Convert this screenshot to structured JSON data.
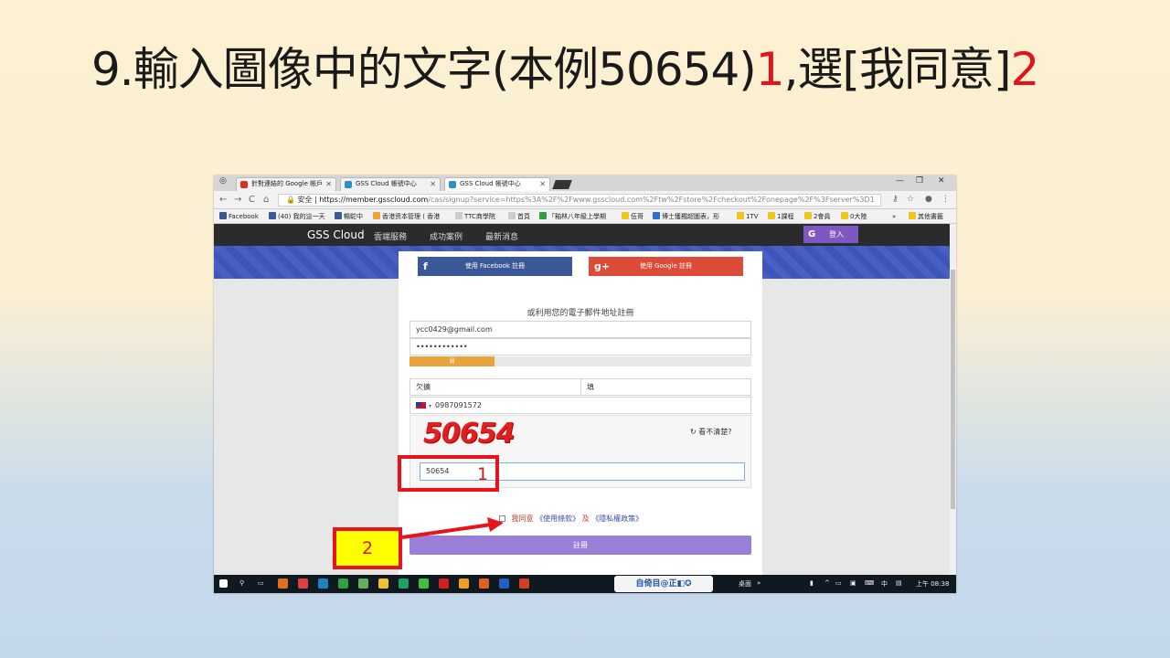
{
  "slide": {
    "title_main": "9.輸入圖像中的文字(本例50654)",
    "title_num1": "1",
    "title_mid": ",選[我同意]",
    "title_num2": "2"
  },
  "browser": {
    "tabs": [
      {
        "label": "針對連結的 Google 帳戶"
      },
      {
        "label": "GSS Cloud 帳號中心"
      },
      {
        "label": "GSS Cloud 帳號中心"
      }
    ],
    "security_label": "安全",
    "url_host": "https://member.gsscloud.com",
    "url_rest": "/cas/signup?service=https%3A%2F%2Fwww.gsscloud.com%2Ftw%2Fstore%2Fcheckout%2Fonepage%2F%3Fserver%3D1",
    "bookmarks": [
      "Facebook",
      "(40) 我的這一天",
      "暢駝中",
      "香港资本管理 ( 香港",
      "TTC商學院",
      "首頁",
      "「釉林八年級上學期",
      "伍哥",
      "博士獲獨超圖表，形",
      "1TV",
      "1課程",
      "2會員",
      "0大陸",
      "»",
      "其他書籤"
    ]
  },
  "site": {
    "brand": "GSS Cloud",
    "nav": [
      "雲端服務",
      "成功案例",
      "最新消息"
    ],
    "login_icon": "G",
    "login_label": "登入"
  },
  "form": {
    "facebook_label": "使用 Facebook 註冊",
    "google_label": "使用 Google 註冊",
    "or_email_text": "或利用您的電子郵件地址註冊",
    "email_value": "ycc0429@gmail.com",
    "password_value": "••••••••••••",
    "strength_label": "弱",
    "lastname_value": "欠擴",
    "firstname_value": "填",
    "phone_value": "0987091572",
    "captcha_text": "50654",
    "refresh_label": "看不清楚?",
    "captcha_input_value": "50654",
    "agree_text": "我同意",
    "terms_link": "《使用條款》",
    "and_text": "及",
    "privacy_link": "《隱私權政策》",
    "submit_label": "註冊"
  },
  "taskbar": {
    "ime_text": "自倚目@正◧✪",
    "desktop_label": "桌面",
    "lang": "中",
    "clock": "上午 08:38"
  },
  "annotations": {
    "step1": "1",
    "step2": "2"
  },
  "colors": {
    "accent_red": "#e0141a",
    "annotation_yellow": "#ffff00",
    "facebook_blue": "#3b5998",
    "google_red": "#dd4b39",
    "submit_purple": "#9b7ed8",
    "login_purple": "#7e57c2"
  }
}
